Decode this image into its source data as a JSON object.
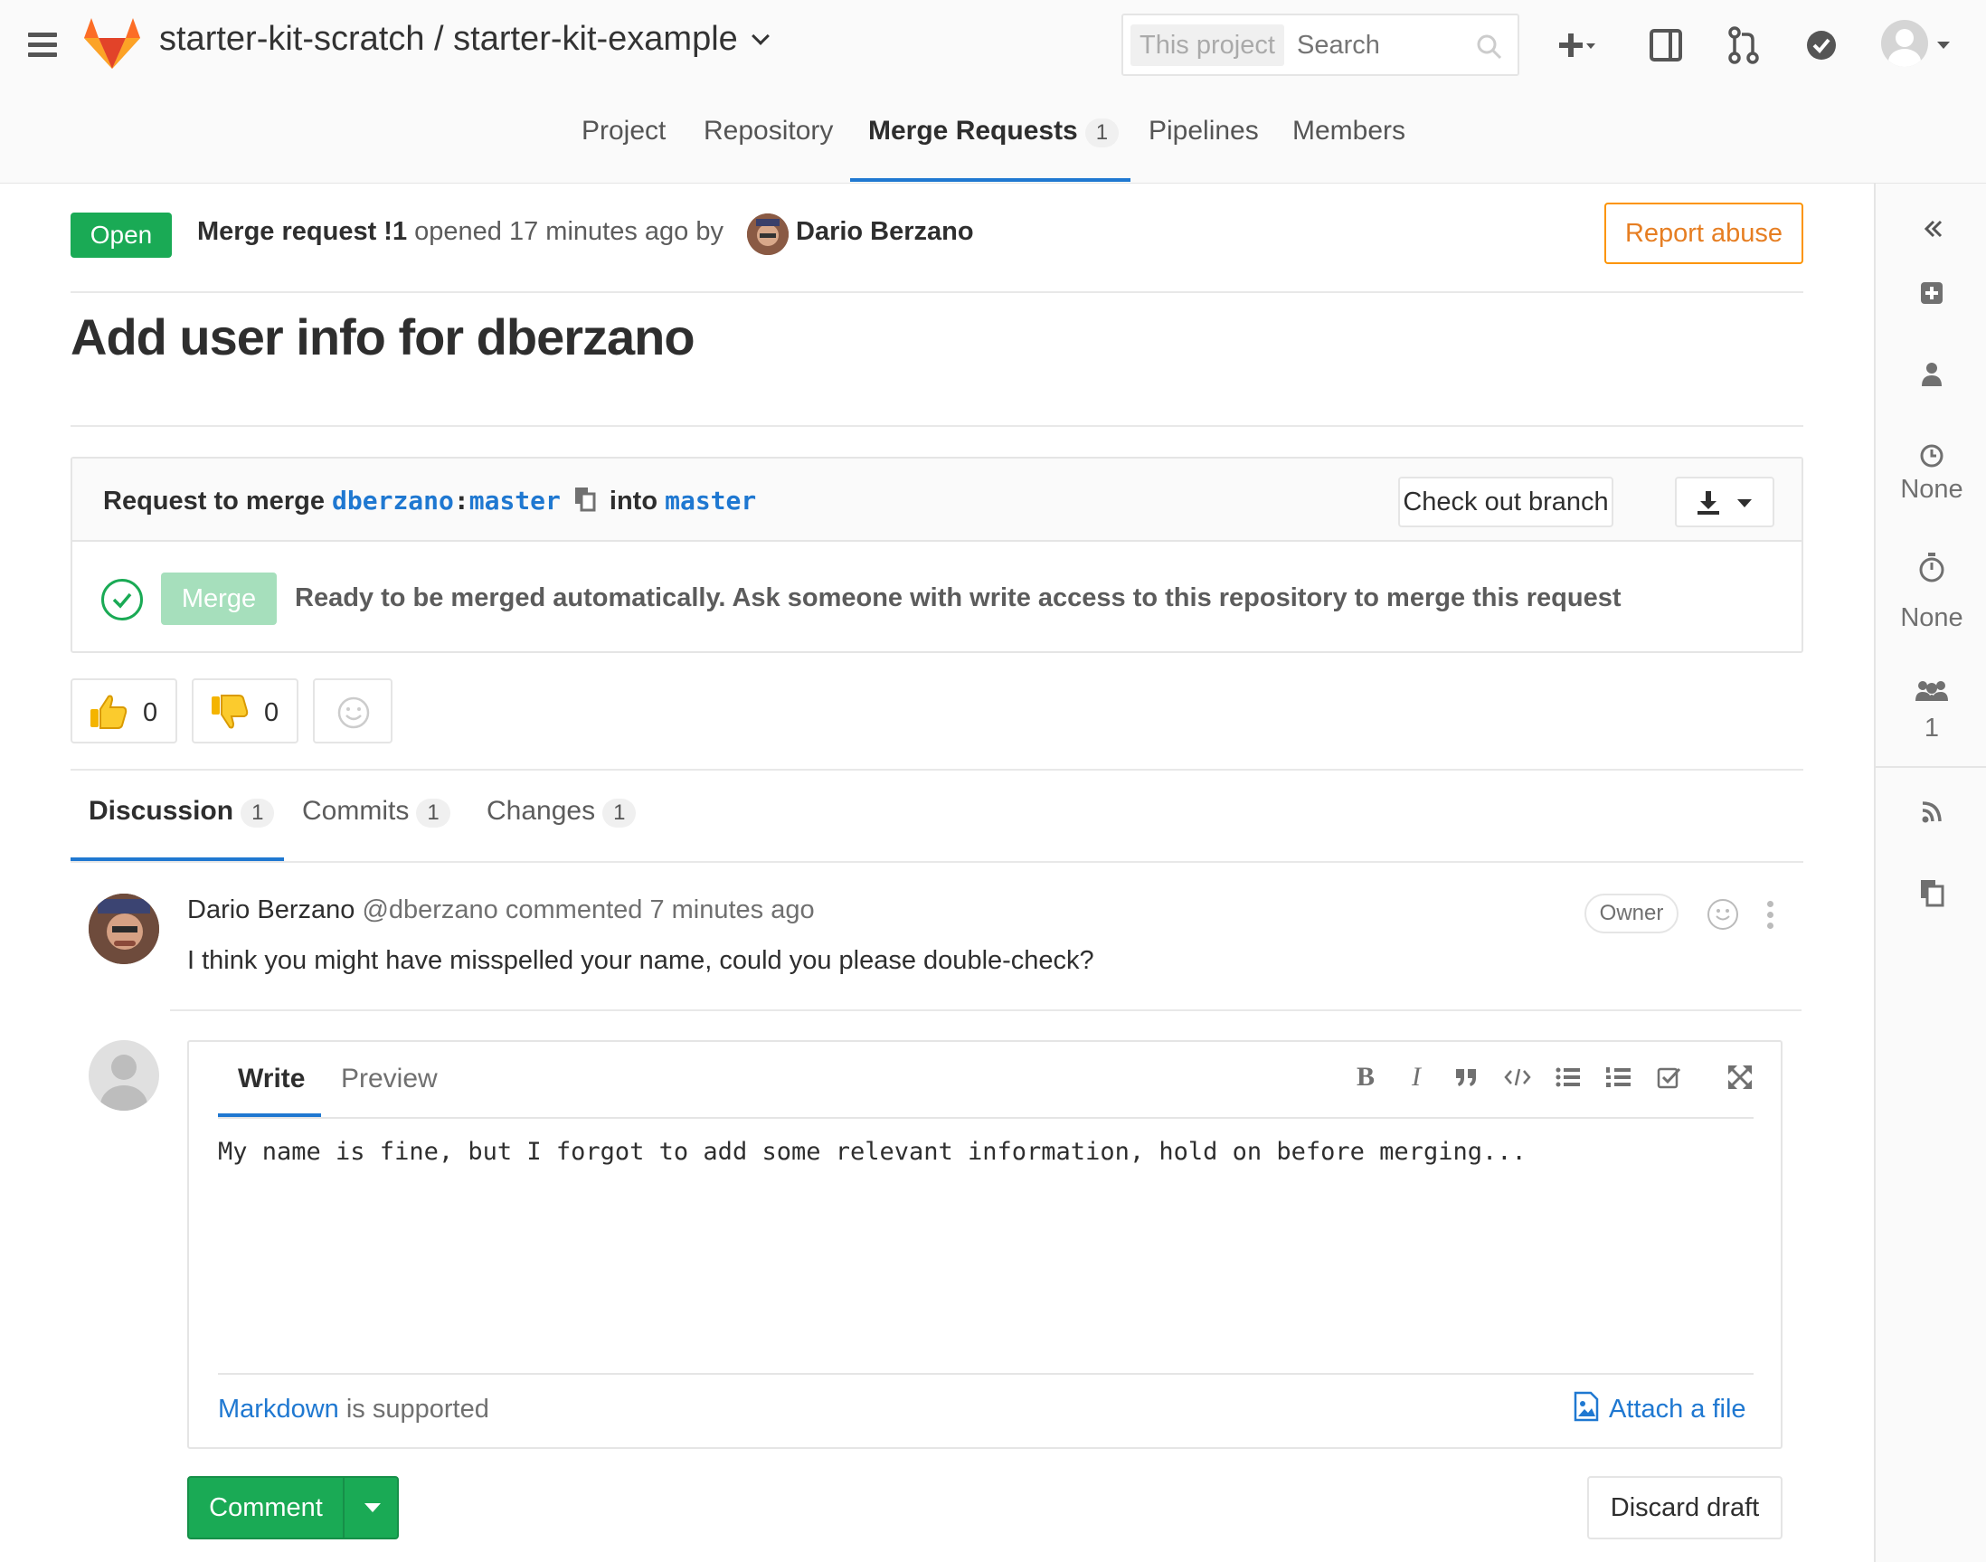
{
  "header": {
    "project_path": "starter-kit-scratch / starter-kit-example",
    "search_scope": "This project",
    "search_placeholder": "Search"
  },
  "nav": {
    "tabs": [
      {
        "label": "Project"
      },
      {
        "label": "Repository"
      },
      {
        "label": "Merge Requests",
        "count": "1",
        "active": true
      },
      {
        "label": "Pipelines"
      },
      {
        "label": "Members"
      }
    ]
  },
  "merge_request": {
    "status": "Open",
    "ref_label": "Merge request !1",
    "opened_text": "opened 17 minutes ago by",
    "author": "Dario Berzano",
    "report_abuse": "Report abuse",
    "title": "Add user info for dberzano",
    "request_to_merge": "Request to merge",
    "source_user": "dberzano",
    "source_colon": ":",
    "source_branch": "master",
    "into": "into",
    "target_branch": "master",
    "checkout_label": "Check out branch",
    "merge_label": "Merge",
    "merge_status": "Ready to be merged automatically. Ask someone with write access to this repository to merge this request"
  },
  "awards": {
    "thumbs_up": "0",
    "thumbs_down": "0"
  },
  "tabs": [
    {
      "label": "Discussion",
      "count": "1",
      "active": true
    },
    {
      "label": "Commits",
      "count": "1"
    },
    {
      "label": "Changes",
      "count": "1"
    }
  ],
  "comment": {
    "author": "Dario Berzano",
    "handle": "@dberzano",
    "meta": "commented 7 minutes ago",
    "role": "Owner",
    "body": "I think you might have misspelled your name, could you please double-check?"
  },
  "editor": {
    "tab_write": "Write",
    "tab_preview": "Preview",
    "text": "My name is fine, but I forgot to add some relevant information, hold on before merging...",
    "markdown_link": "Markdown",
    "markdown_suffix": " is supported",
    "attach_label": "Attach a file",
    "toolbar": {
      "bold": "B",
      "italic": "I"
    }
  },
  "actions": {
    "comment_label": "Comment",
    "discard_label": "Discard draft"
  },
  "sidebar": {
    "milestone": "None",
    "time_tracking": "None",
    "participants": "1"
  },
  "colors": {
    "accent": "#1f78d1",
    "success": "#1aaa55",
    "warning": "#fc9403"
  }
}
